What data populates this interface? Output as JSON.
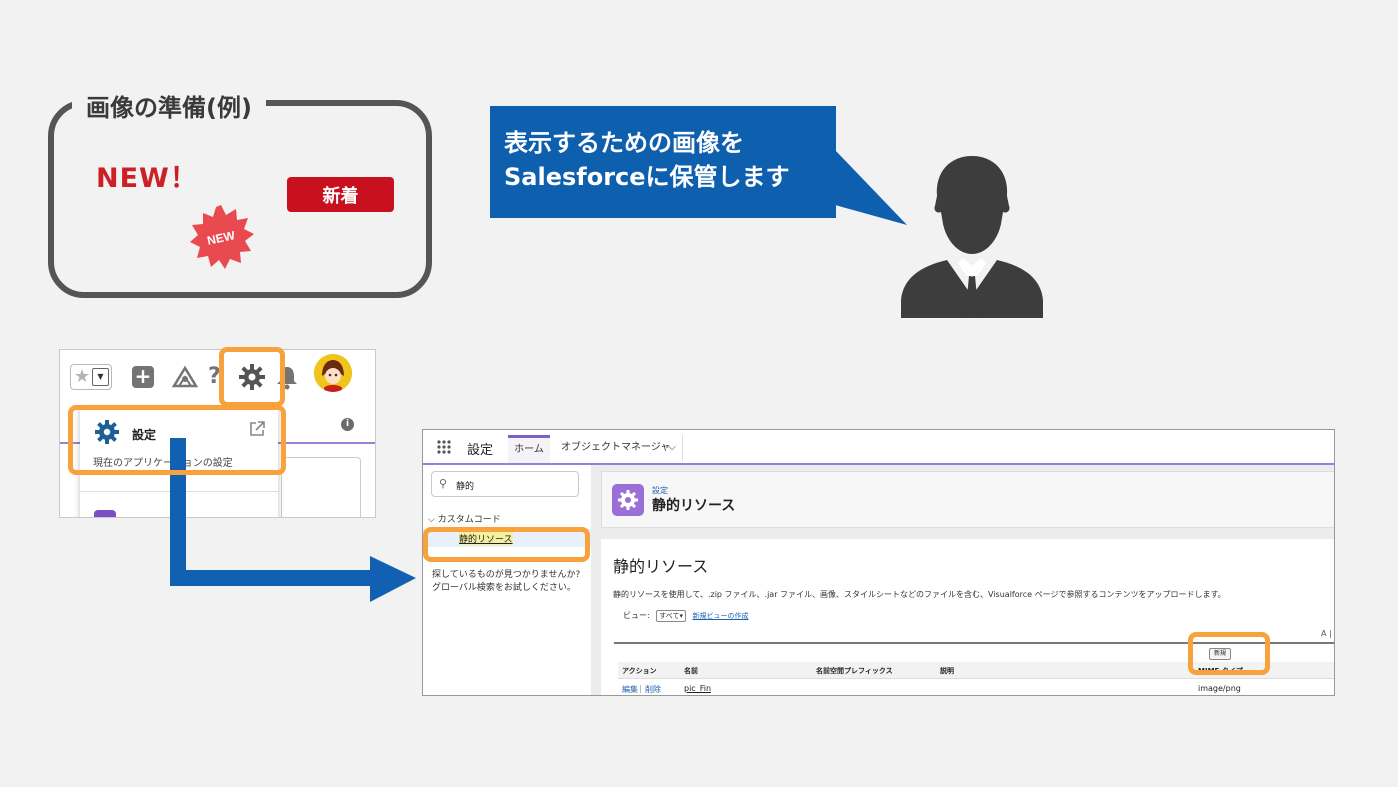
{
  "prep": {
    "title": "画像の準備(例)",
    "sample_new_text": "NEW！",
    "sample_badge": "新着",
    "sample_burst": "NEW"
  },
  "bubble": {
    "line1": "表示するための画像を",
    "line2": "Salesforceに保管します"
  },
  "header_shot": {
    "menu_title": "設定",
    "menu_subtitle": "現在のアプリケーションの設定",
    "icons": [
      "star-icon",
      "chevron-down-icon",
      "plus-icon",
      "trailhead-icon",
      "help-icon",
      "gear-icon",
      "bell-icon",
      "avatar-icon",
      "external-link-icon",
      "info-icon"
    ]
  },
  "setup_shot": {
    "app_title": "設定",
    "tabs": [
      {
        "label": "ホーム",
        "active": true
      },
      {
        "label": "オブジェクトマネージャ",
        "active": false
      }
    ],
    "search_value": "静的",
    "tree_section": "カスタムコード",
    "tree_item": "静的リソース",
    "not_found": "探しているものが見つかりませんか? グローバル検索をお試しください。",
    "breadcrumb": "設定",
    "page_title": "静的リソース",
    "body_title": "静的リソース",
    "description": "静的リソースを使用して、.zip ファイル、.jar ファイル、画像、スタイルシートなどのファイルを含む、Visualforce ページで参照するコンテンツをアップロードします。",
    "view_label": "ビュー:",
    "view_select": "すべて",
    "view_link": "新規ビューの作成",
    "az_marker": "A |",
    "new_button": "新規",
    "columns": [
      "アクション",
      "名前",
      "名前空間プレフィックス",
      "説明",
      "MIME タイプ"
    ],
    "rows": [
      {
        "edit": "編集",
        "sep": "|",
        "delete": "削除",
        "name": "pic_Fin",
        "mime": "image/png"
      }
    ]
  },
  "colors": {
    "highlight": "#f7a23c",
    "bubble_blue": "#0e5fae",
    "badge_red": "#c8101e",
    "sf_purple": "#9b7fd6"
  }
}
